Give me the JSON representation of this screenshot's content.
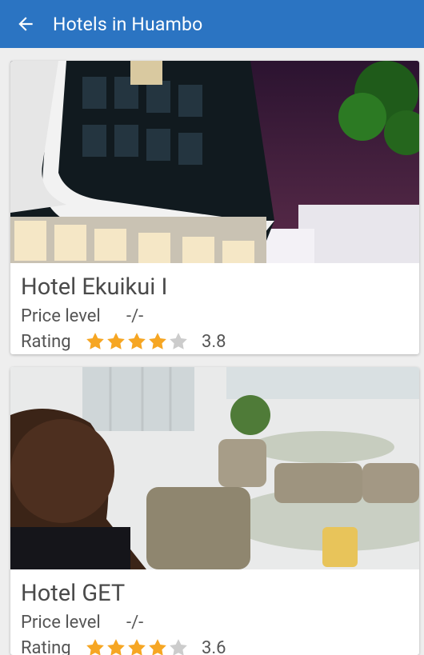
{
  "appbar": {
    "title": "Hotels in Huambo"
  },
  "hotels": [
    {
      "name": "Hotel Ekuikui I",
      "price_label": "Price level",
      "price": "-/-",
      "rating_label": "Rating",
      "rating": 3.8,
      "rating_text": "3.8",
      "image": "photo of a modern hotel building at night"
    },
    {
      "name": "Hotel GET",
      "price_label": "Price level",
      "price": "-/-",
      "rating_label": "Rating",
      "rating": 3.6,
      "rating_text": "3.6",
      "image": "selfie photo in a hotel terrace with wicker chairs and glass tables"
    }
  ],
  "colors": {
    "appbar": "#2b74c2",
    "star_filled": "#f6a623",
    "star_empty": "#cccccc"
  }
}
